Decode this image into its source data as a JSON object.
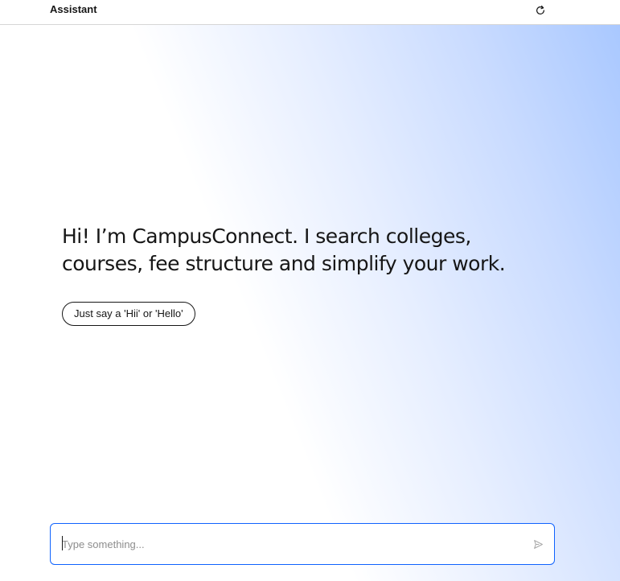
{
  "header": {
    "title": "Assistant",
    "refresh_icon": "refresh-icon"
  },
  "main": {
    "greeting": "Hi! I’m CampusConnect. I search colleges, courses, fee structure and simplify your work.",
    "suggestion": "Just say a 'Hii' or 'Hello'"
  },
  "composer": {
    "placeholder": "Type something...",
    "value": "",
    "send_icon": "send-icon"
  },
  "colors": {
    "accent": "#0f62fe",
    "text": "#161616",
    "gradient_end": "#a9c8ff"
  }
}
